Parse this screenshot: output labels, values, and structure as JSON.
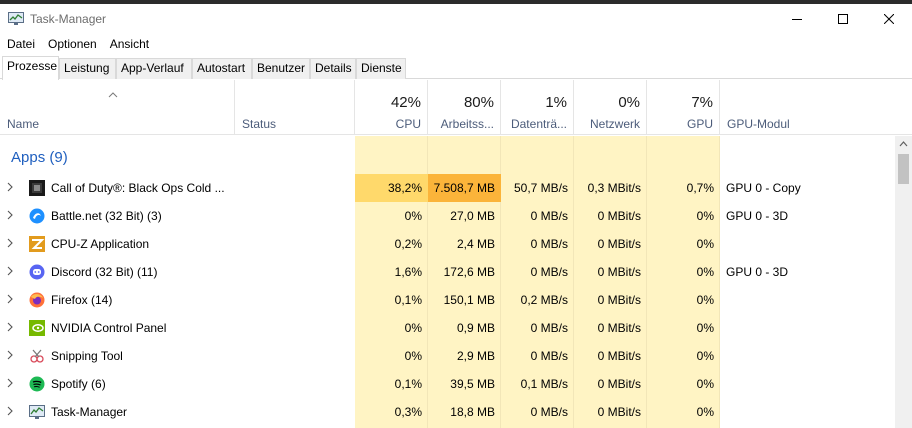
{
  "window": {
    "title": "Task-Manager",
    "accent_color": "#1f5fbf"
  },
  "menu": {
    "items": [
      "Datei",
      "Optionen",
      "Ansicht"
    ]
  },
  "tabs": [
    "Prozesse",
    "Leistung",
    "App-Verlauf",
    "Autostart",
    "Benutzer",
    "Details",
    "Dienste"
  ],
  "active_tab": "Prozesse",
  "columns": {
    "name": "Name",
    "status": "Status",
    "cpu": {
      "percent": "42%",
      "label": "CPU"
    },
    "memory": {
      "percent": "80%",
      "label": "Arbeitss..."
    },
    "disk": {
      "percent": "1%",
      "label": "Datenträ..."
    },
    "network": {
      "percent": "0%",
      "label": "Netzwerk"
    },
    "gpu": {
      "percent": "7%",
      "label": "GPU"
    },
    "gpu_engine": "GPU-Modul"
  },
  "group": {
    "label": "Apps (9)"
  },
  "processes": [
    {
      "name": "Call of Duty®: Black Ops Cold ...",
      "icon": "cod-icon",
      "status": "",
      "cpu": "38,2%",
      "memory": "7.508,7 MB",
      "disk": "50,7 MB/s",
      "network": "0,3 MBit/s",
      "gpu": "0,7%",
      "gpu_engine": "GPU 0 - Copy"
    },
    {
      "name": "Battle.net (32 Bit) (3)",
      "icon": "battlenet-icon",
      "status": "",
      "cpu": "0%",
      "memory": "27,0 MB",
      "disk": "0 MB/s",
      "network": "0 MBit/s",
      "gpu": "0%",
      "gpu_engine": "GPU 0 - 3D"
    },
    {
      "name": "CPU-Z Application",
      "icon": "cpuz-icon",
      "status": "",
      "cpu": "0,2%",
      "memory": "2,4 MB",
      "disk": "0 MB/s",
      "network": "0 MBit/s",
      "gpu": "0%",
      "gpu_engine": ""
    },
    {
      "name": "Discord (32 Bit) (11)",
      "icon": "discord-icon",
      "status": "",
      "cpu": "1,6%",
      "memory": "172,6 MB",
      "disk": "0 MB/s",
      "network": "0 MBit/s",
      "gpu": "0%",
      "gpu_engine": "GPU 0 - 3D"
    },
    {
      "name": "Firefox (14)",
      "icon": "firefox-icon",
      "status": "",
      "cpu": "0,1%",
      "memory": "150,1 MB",
      "disk": "0,2 MB/s",
      "network": "0 MBit/s",
      "gpu": "0%",
      "gpu_engine": ""
    },
    {
      "name": "NVIDIA Control Panel",
      "icon": "nvidia-icon",
      "status": "",
      "cpu": "0%",
      "memory": "0,9 MB",
      "disk": "0 MB/s",
      "network": "0 MBit/s",
      "gpu": "0%",
      "gpu_engine": ""
    },
    {
      "name": "Snipping Tool",
      "icon": "snipping-tool-icon",
      "status": "",
      "cpu": "0%",
      "memory": "2,9 MB",
      "disk": "0 MB/s",
      "network": "0 MBit/s",
      "gpu": "0%",
      "gpu_engine": ""
    },
    {
      "name": "Spotify (6)",
      "icon": "spotify-icon",
      "status": "",
      "cpu": "0,1%",
      "memory": "39,5 MB",
      "disk": "0,1 MB/s",
      "network": "0 MBit/s",
      "gpu": "0%",
      "gpu_engine": ""
    },
    {
      "name": "Task-Manager",
      "icon": "taskmanager-icon",
      "status": "",
      "cpu": "0,3%",
      "memory": "18,8 MB",
      "disk": "0 MB/s",
      "network": "0 MBit/s",
      "gpu": "0%",
      "gpu_engine": ""
    }
  ],
  "heat_colors": {
    "low": "#fff4c4",
    "medium": "#ffd96b",
    "high": "#fbb43a"
  }
}
